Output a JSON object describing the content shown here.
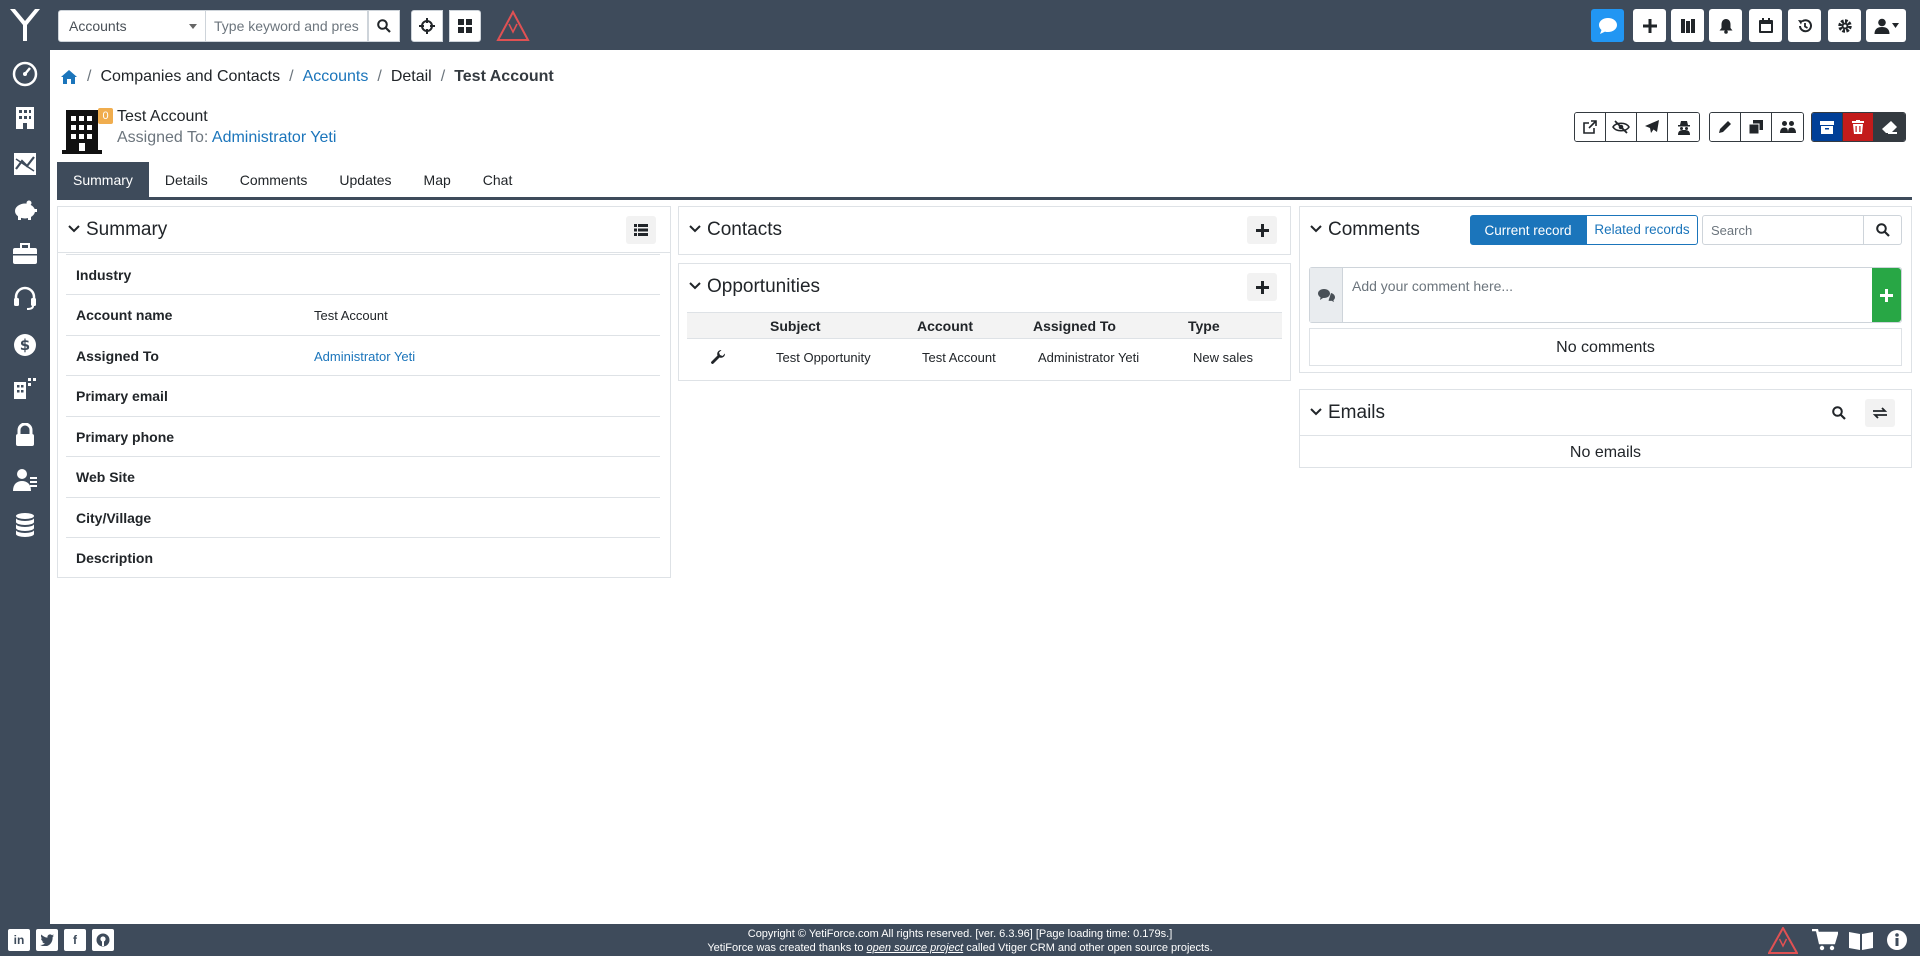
{
  "topbar": {
    "module": "Accounts",
    "search_placeholder": "Type keyword and press"
  },
  "breadcrumb": {
    "companies": "Companies and Contacts",
    "accounts": "Accounts",
    "detail": "Detail",
    "record": "Test Account",
    "sep": "/"
  },
  "record": {
    "badge": "0",
    "title": "Test Account",
    "assigned_label": "Assigned To:",
    "assigned_value": "Administrator Yeti"
  },
  "tabs": [
    "Summary",
    "Details",
    "Comments",
    "Updates",
    "Map",
    "Chat"
  ],
  "summary": {
    "title": "Summary",
    "fields": [
      {
        "label": "Industry",
        "value": ""
      },
      {
        "label": "Account name",
        "value": "Test Account"
      },
      {
        "label": "Assigned To",
        "value": "Administrator Yeti"
      },
      {
        "label": "Primary email",
        "value": ""
      },
      {
        "label": "Primary phone",
        "value": ""
      },
      {
        "label": "Web Site",
        "value": ""
      },
      {
        "label": "City/Village",
        "value": ""
      },
      {
        "label": "Description",
        "value": ""
      }
    ]
  },
  "contacts": {
    "title": "Contacts"
  },
  "opportunities": {
    "title": "Opportunities",
    "headers": [
      "Subject",
      "Account",
      "Assigned To",
      "Type"
    ],
    "rows": [
      {
        "subject": "Test Opportunity",
        "account": "Test Account",
        "assigned": "Administrator Yeti",
        "type": "New sales"
      }
    ]
  },
  "comments": {
    "title": "Comments",
    "current_record": "Current record",
    "related_records": "Related records",
    "search_placeholder": "Search",
    "input_placeholder": "Add your comment here...",
    "empty": "No comments"
  },
  "emails": {
    "title": "Emails",
    "empty": "No emails"
  },
  "footer": {
    "line1": "Copyright © YetiForce.com All rights reserved. [ver. 6.3.96] [Page loading time: 0.179s.]",
    "line2_pre": "YetiForce was created thanks to ",
    "line2_link": "open source project",
    "line2_post": " called Vtiger CRM and other open source projects."
  },
  "colors": {
    "nav": "#3e4b5b",
    "link": "#1b75bb",
    "badge": "#f0ad4e",
    "add": "#28a745",
    "archive": "#003f97",
    "delete": "#c31b1b",
    "warning": "#e05153"
  }
}
